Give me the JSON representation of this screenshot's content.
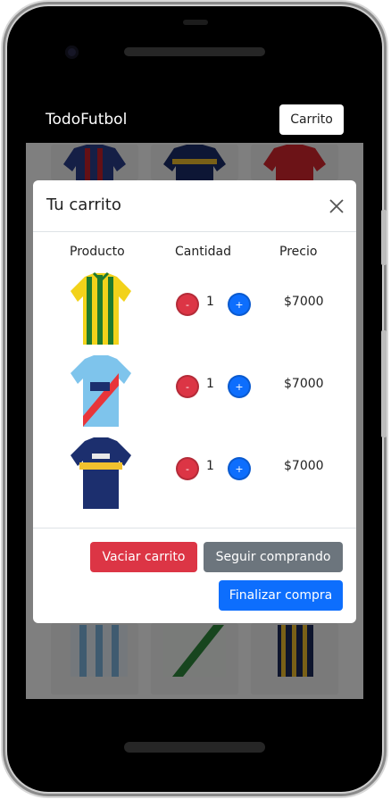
{
  "navbar": {
    "brand": "TodoFutbol",
    "cart_button": "Carrito"
  },
  "modal": {
    "title": "Tu carrito",
    "columns": [
      "Producto",
      "Cantidad",
      "Precio"
    ],
    "items": [
      {
        "product": "jersey-green-yellow",
        "quantity": "1",
        "price": "$7000",
        "minus": "-",
        "plus": "+"
      },
      {
        "product": "jersey-lightblue-red-sash",
        "quantity": "1",
        "price": "$7000",
        "minus": "-",
        "plus": "+"
      },
      {
        "product": "jersey-navy-yellow",
        "quantity": "1",
        "price": "$7000",
        "minus": "-",
        "plus": "+"
      }
    ],
    "buttons": {
      "empty_cart": "Vaciar carrito",
      "continue_shopping": "Seguir comprando",
      "checkout": "Finalizar compra"
    }
  },
  "colors": {
    "danger": "#dc3545",
    "secondary": "#6c757d",
    "primary": "#0d6efd",
    "navbar_bg": "#000000"
  }
}
